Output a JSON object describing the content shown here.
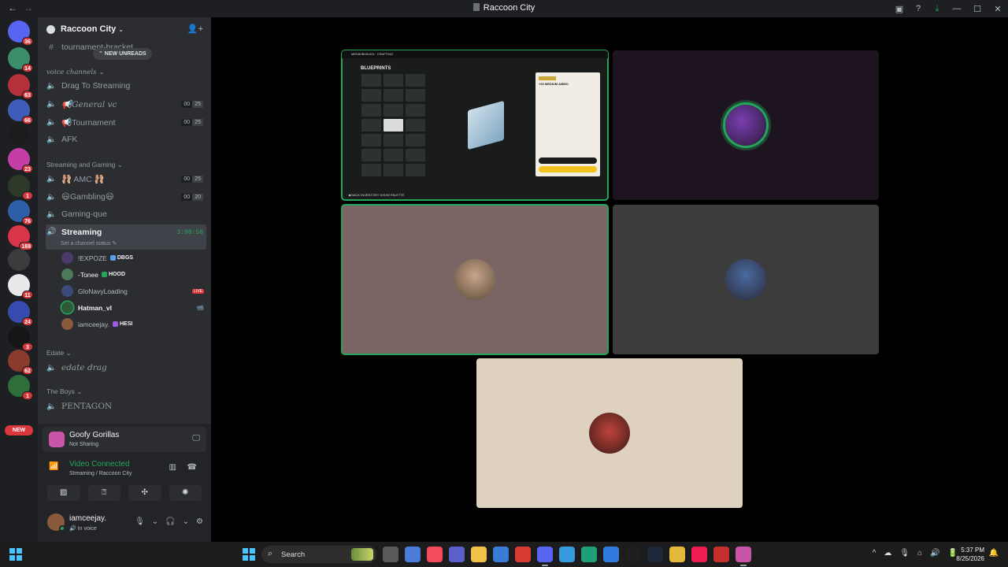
{
  "window": {
    "title": "Raccoon City",
    "back": "←",
    "forward": "→",
    "right_icons": [
      "▣",
      "?",
      "⤓"
    ],
    "controls": [
      "—",
      "☐",
      "✕"
    ]
  },
  "servers": [
    {
      "badge": "36",
      "color": "#5865f2"
    },
    {
      "badge": "14",
      "color": "#3a8f6a"
    },
    {
      "badge": "63",
      "color": "#b5303b"
    },
    {
      "badge": "66",
      "color": "#3e5db8"
    },
    {
      "badge": "",
      "color": "#1c1c1c"
    },
    {
      "badge": "23",
      "color": "#c33ea5"
    },
    {
      "badge": "1",
      "color": "#2d3a2a"
    },
    {
      "badge": "76",
      "color": "#2d5fa8"
    },
    {
      "badge": "169",
      "color": "#d8344a"
    },
    {
      "badge": "",
      "color": "#3c3c3c"
    },
    {
      "badge": "11",
      "color": "#e8e8e8"
    },
    {
      "badge": "24",
      "color": "#3a4bb0"
    },
    {
      "badge": "3",
      "color": "#151515"
    },
    {
      "badge": "62",
      "color": "#8a3b2c"
    },
    {
      "badge": "1",
      "color": "#2f6d3a"
    }
  ],
  "new_pill": "NEW",
  "server": {
    "name": "Raccoon City",
    "chevron": "⌄",
    "invite_icon": "👤+"
  },
  "new_unreads": "⌃ NEW UNREADS",
  "top_channel": "tournament-bracket",
  "categories": {
    "voice": "voice channels ⌄",
    "streaming": "Streaming and Gaming ⌄",
    "edate": "Edate ⌄",
    "boys": "The Boys ⌄"
  },
  "channels": {
    "drag": "Drag To Streaming",
    "general": "📢General vc",
    "tournament": "📢Tournament",
    "afk": "AFK",
    "amc": "🩰 AMC 🩰",
    "gambling": "😃Gambling😃",
    "gaming_que": "Gaming-que",
    "streaming": "Streaming",
    "edate_drag": "edate drag",
    "pentagon": "PENTAGON"
  },
  "counts": {
    "general": [
      "00",
      "25"
    ],
    "tournament": [
      "00",
      "25"
    ],
    "amc": [
      "00",
      "25"
    ],
    "gambling": [
      "00",
      "20"
    ]
  },
  "stream_timer": "3:08:58",
  "set_status": "Set a channel status ✎",
  "voice_users": [
    {
      "name": "!EXPOZE",
      "tag": "DBGS",
      "tag_color": "#5aa0f0",
      "av": "#4a3b6a"
    },
    {
      "name": "-Tonee",
      "tag": "HOOD",
      "tag_color": "#23a55a",
      "av": "#4a7a5a"
    },
    {
      "name": "GloNavyLoading",
      "tag": "",
      "tag_color": "",
      "av": "#3b4a7a",
      "end": "LIVE"
    },
    {
      "name": "Hatman_vl",
      "tag": "",
      "tag_color": "",
      "av": "#2e5a3a",
      "end": "📹"
    },
    {
      "name": "iamceejay.",
      "tag": "HESI",
      "tag_color": "#9b59e6",
      "av": "#8a5a3c"
    }
  ],
  "goofy": {
    "name": "Goofy Gorillas",
    "status": "Not Sharing"
  },
  "connection": {
    "title": "Video Connected",
    "sub": "Streaming / Raccoon City"
  },
  "control_buttons": [
    "▨",
    "⍰",
    "✣",
    "✺"
  ],
  "user": {
    "name": "iamceejay.",
    "status": "In voice"
  },
  "tile_colors": {
    "t2": "#1e1420",
    "t3": "#7a6464",
    "t4": "#3c3c3c",
    "t5": "#ded2bf"
  },
  "game": {
    "top": "MEDIKIBOKATA · CRAFTING",
    "blueprints": "BLUEPRINTS",
    "item": "+20 MEDIUM AMMO",
    "bottom": "◀ BACK   INVENTORY   SHOW PALETTE"
  },
  "taskbar": {
    "search": "Search",
    "time": "5:37 PM",
    "date": "8/25/2026",
    "tray": [
      "^",
      "☁",
      "🎙",
      "⌂",
      "🔊",
      "🔋"
    ],
    "apps": [
      "#5a5a5a",
      "#4a7bd8",
      "#f34a5c",
      "#5b5fc7",
      "#f2c14b",
      "#3a7bd5",
      "#d83b31",
      "#5865f2",
      "#3a9bdc",
      "#1f9e7a",
      "#2f7be0",
      "#1f1f1f",
      "#1b2838",
      "#e4b83a",
      "#ee1d52",
      "#c4302b",
      "#c855a8"
    ]
  }
}
